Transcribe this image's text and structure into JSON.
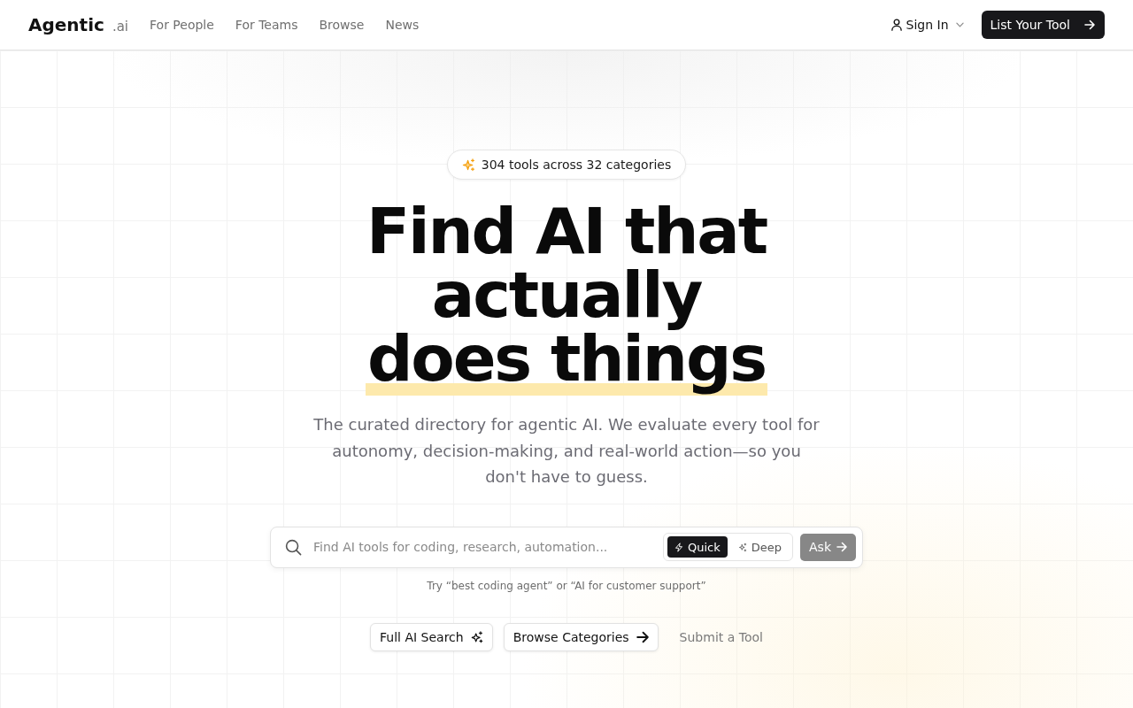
{
  "header": {
    "logo": {
      "name": "Agentic",
      "suffix": ".ai"
    },
    "nav": [
      {
        "label": "For People"
      },
      {
        "label": "For Teams"
      },
      {
        "label": "Browse"
      },
      {
        "label": "News"
      }
    ],
    "sign_in": {
      "label": "Sign In"
    },
    "cta": {
      "label": "List Your Tool"
    }
  },
  "hero": {
    "badge": "304 tools across 32 categories",
    "headline": {
      "lead": "Find AI that actually",
      "highlighted": "does things"
    },
    "subtitle": "The curated directory for agentic AI. We evaluate every tool for autonomy, decision-making, and real-world action—so you don't have to guess.",
    "search": {
      "placeholder": "Find AI tools for coding, research, automation...",
      "modes": [
        {
          "label": "Quick",
          "selected": true
        },
        {
          "label": "Deep",
          "selected": false
        }
      ],
      "submit": {
        "label": "Ask",
        "disabled": true
      }
    },
    "hint": "Try “best coding agent” or “AI for customer support”",
    "actions": [
      {
        "label": "Full AI Search",
        "kind": "search"
      },
      {
        "label": "Browse Categories",
        "kind": "browse"
      },
      {
        "label": "Submit a Tool",
        "kind": "link"
      }
    ]
  }
}
